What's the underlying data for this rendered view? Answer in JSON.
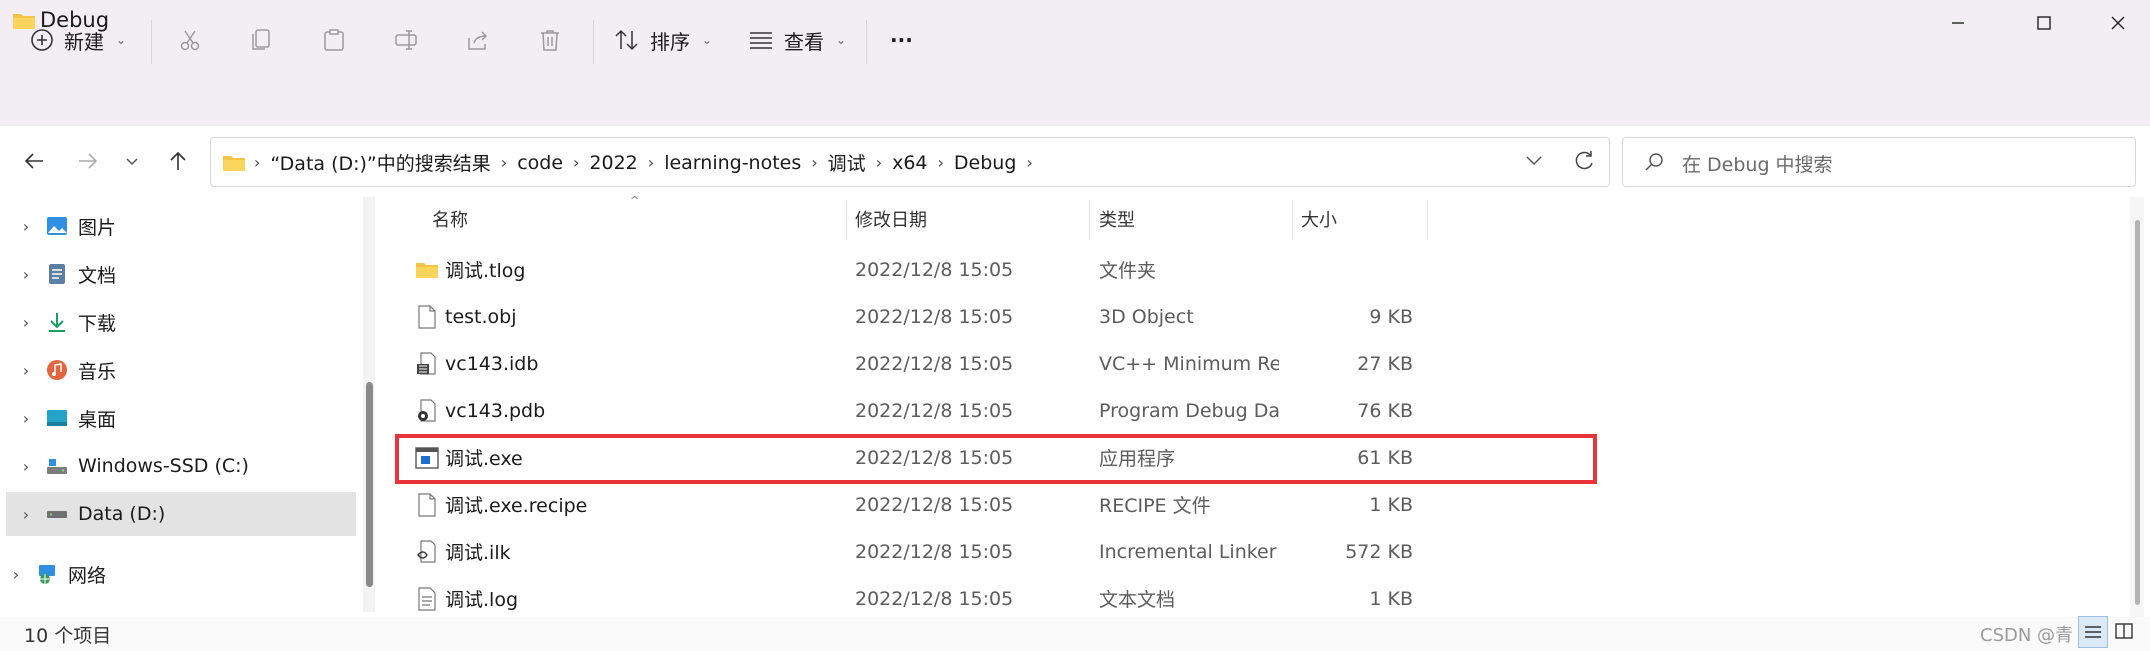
{
  "window": {
    "title": "Debug"
  },
  "toolbar": {
    "new_label": "新建",
    "sort_label": "排序",
    "view_label": "查看",
    "more_label": "···"
  },
  "address": {
    "crumbs": [
      "“Data (D:)”中的搜索结果",
      "code",
      "2022",
      "learning-notes",
      "调试",
      "x64",
      "Debug"
    ]
  },
  "search": {
    "placeholder": "在 Debug 中搜索"
  },
  "nav": {
    "items": [
      {
        "label": "图片",
        "icon": "pictures-icon"
      },
      {
        "label": "文档",
        "icon": "documents-icon"
      },
      {
        "label": "下载",
        "icon": "downloads-icon"
      },
      {
        "label": "音乐",
        "icon": "music-icon"
      },
      {
        "label": "桌面",
        "icon": "desktop-icon"
      },
      {
        "label": "Windows-SSD (C:)",
        "icon": "drive-icon"
      },
      {
        "label": "Data (D:)",
        "icon": "drive-icon",
        "selected": true
      },
      {
        "label": "网络",
        "icon": "network-icon"
      }
    ]
  },
  "columns": {
    "name": "名称",
    "date": "修改日期",
    "type": "类型",
    "size": "大小"
  },
  "files": [
    {
      "name": "调试.tlog",
      "date": "2022/12/8 15:05",
      "type": "文件夹",
      "size": "",
      "icon": "folder-icon"
    },
    {
      "name": "test.obj",
      "date": "2022/12/8 15:05",
      "type": "3D Object",
      "size": "9 KB",
      "icon": "file-icon"
    },
    {
      "name": "vc143.idb",
      "date": "2022/12/8 15:05",
      "type": "VC++ Minimum Re...",
      "size": "27 KB",
      "icon": "idb-file-icon"
    },
    {
      "name": "vc143.pdb",
      "date": "2022/12/8 15:05",
      "type": "Program Debug Da...",
      "size": "76 KB",
      "icon": "pdb-file-icon"
    },
    {
      "name": "调试.exe",
      "date": "2022/12/8 15:05",
      "type": "应用程序",
      "size": "61 KB",
      "icon": "exe-icon"
    },
    {
      "name": "调试.exe.recipe",
      "date": "2022/12/8 15:05",
      "type": "RECIPE 文件",
      "size": "1 KB",
      "icon": "file-icon"
    },
    {
      "name": "调试.ilk",
      "date": "2022/12/8 15:05",
      "type": "Incremental Linker ...",
      "size": "572 KB",
      "icon": "ilk-file-icon"
    },
    {
      "name": "调试.log",
      "date": "2022/12/8 15:05",
      "type": "文本文档",
      "size": "1 KB",
      "icon": "text-file-icon"
    }
  ],
  "status": {
    "count": "10 个项目",
    "watermark": "CSDN @青 芸"
  },
  "colors": {
    "highlight": "#e8333a",
    "accent": "#0067c0",
    "folder": "#f4c542"
  }
}
